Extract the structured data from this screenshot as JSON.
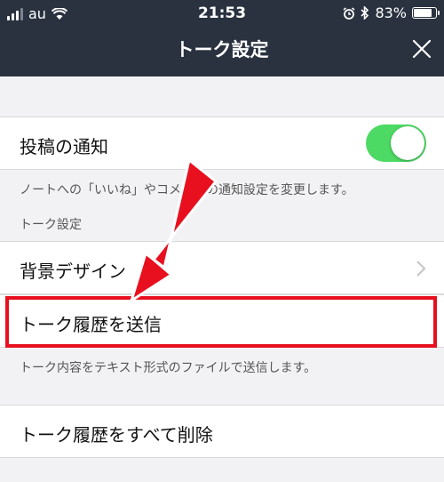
{
  "status_bar": {
    "carrier": "au",
    "time": "21:53",
    "battery": "83%",
    "battery_level": 0.83
  },
  "header": {
    "title": "トーク設定",
    "close_icon": "close-icon"
  },
  "sections": {
    "post_notification": {
      "label": "投稿の通知",
      "toggle_on": true,
      "note": "ノートへの「いいね」やコメントの通知設定を変更します。"
    },
    "talk_settings_header": "トーク設定",
    "background_design": {
      "label": "背景デザイン"
    },
    "send_history": {
      "label": "トーク履歴を送信",
      "note": "トーク内容をテキスト形式のファイルで送信します。"
    },
    "delete_history": {
      "label": "トーク履歴をすべて削除"
    }
  },
  "colors": {
    "header_bg": "#2a3240",
    "toggle_on": "#4cd964",
    "highlight": "#e8101f"
  }
}
